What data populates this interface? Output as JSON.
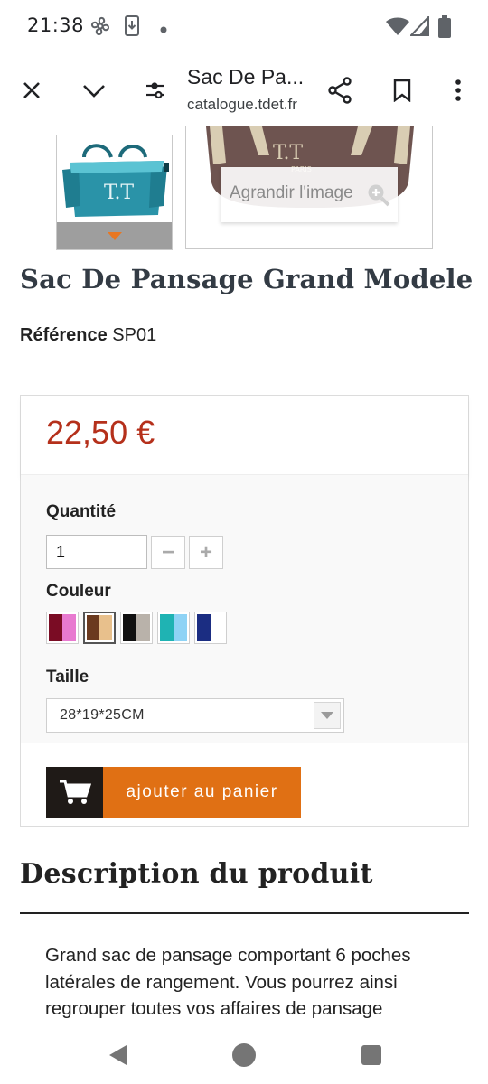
{
  "status_bar": {
    "time": "21:38"
  },
  "browser": {
    "page_title": "Sac De Pa...",
    "url": "catalogue.tdet.fr"
  },
  "gallery": {
    "zoom_label": "Agrandir l'image"
  },
  "product": {
    "title": "Sac De Pansage Grand Modele",
    "reference_label": "Référence",
    "reference_value": "SP01",
    "price": "22,50 €"
  },
  "options": {
    "quantity_label": "Quantité",
    "quantity_value": "1",
    "minus_symbol": "−",
    "plus_symbol": "+",
    "color_label": "Couleur",
    "colors": [
      {
        "left": "#7a0c24",
        "right": "#e87ad0",
        "selected": false
      },
      {
        "left": "#6b3a1f",
        "right": "#e8c08c",
        "selected": true
      },
      {
        "left": "#111111",
        "right": "#b9b2aa",
        "selected": false
      },
      {
        "left": "#1fb3b3",
        "right": "#8fd3f5",
        "selected": false
      },
      {
        "left": "#1b2d82",
        "right": "#ffffff",
        "selected": false
      }
    ],
    "size_label": "Taille",
    "size_value": "28*19*25CM"
  },
  "cart": {
    "button_label": "ajouter au panier",
    "accent_color": "#e07014"
  },
  "description": {
    "title": "Description du produit",
    "text": "Grand sac de pansage comportant 6 poches latérales de rangement. Vous pourrez ainsi regrouper toutes vos affaires de pansage"
  }
}
